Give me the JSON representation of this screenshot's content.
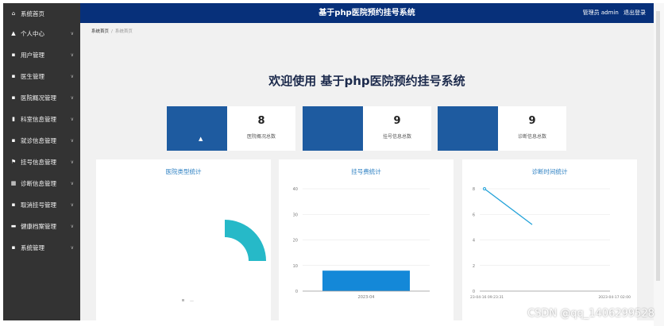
{
  "colors": {
    "sidebar_bg": "#333333",
    "topbar_bg": "#07307a",
    "card_blue": "#1e5ba0",
    "panel_title": "#2b7fc2",
    "pie": "#26b9c8",
    "bar": "#1488d8",
    "line": "#23a2d9"
  },
  "sidebar": {
    "items": [
      {
        "label": "系统首页",
        "icon": "home-icon",
        "glyph": "⌂"
      },
      {
        "label": "个人中心",
        "icon": "user-icon",
        "glyph": "▲"
      },
      {
        "label": "用户管理",
        "icon": "grid-icon",
        "glyph": "▪"
      },
      {
        "label": "医生管理",
        "icon": "grid-icon",
        "glyph": "▪"
      },
      {
        "label": "医院概况管理",
        "icon": "grid-icon",
        "glyph": "▪"
      },
      {
        "label": "科室信息管理",
        "icon": "trash-icon",
        "glyph": "▮"
      },
      {
        "label": "就诊信息管理",
        "icon": "grid-icon",
        "glyph": "▪"
      },
      {
        "label": "挂号信息管理",
        "icon": "flag-icon",
        "glyph": "⚑"
      },
      {
        "label": "诊断信息管理",
        "icon": "table-icon",
        "glyph": "▦"
      },
      {
        "label": "取消挂号管理",
        "icon": "grid-icon",
        "glyph": "▪"
      },
      {
        "label": "健康档案管理",
        "icon": "bag-icon",
        "glyph": "▬"
      },
      {
        "label": "系统管理",
        "icon": "grid-icon",
        "glyph": "▪"
      }
    ]
  },
  "topbar": {
    "title": "基于php医院预约挂号系统",
    "role": "管理员 admin",
    "logout": "退出登录"
  },
  "breadcrumb": {
    "home": "系统首页",
    "separator": "/",
    "current": "系统首页"
  },
  "welcome": "欢迎使用 基于php医院预约挂号系统",
  "cards": [
    {
      "value": "8",
      "label": "医院概况总数"
    },
    {
      "value": "9",
      "label": "挂号信息总数"
    },
    {
      "value": "9",
      "label": "诊断信息总数"
    }
  ],
  "chart_data": [
    {
      "type": "pie",
      "title": "医院类型统计",
      "slices": [
        {
          "name": "",
          "value": 1
        }
      ],
      "legend_label": "—"
    },
    {
      "type": "bar",
      "title": "挂号费统计",
      "categories": [
        "2023-04"
      ],
      "values": [
        8
      ],
      "ylim": [
        0,
        40
      ],
      "yticks": [
        "0",
        "10",
        "20",
        "30",
        "40"
      ]
    },
    {
      "type": "line",
      "title": "诊断时间统计",
      "x": [
        "23-04-16 09:23:31",
        "2023-04-17 02:00"
      ],
      "y": [
        8,
        5.2
      ],
      "ylim": [
        0,
        8
      ],
      "yticks": [
        "0",
        "2",
        "4",
        "6",
        "8"
      ],
      "xtick_labels": [
        "23-04-16 09:23:31",
        "2023-04-17 02:00"
      ]
    }
  ],
  "watermark": "CSDN @qq_1406299528"
}
